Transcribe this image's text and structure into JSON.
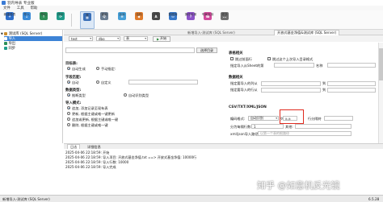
{
  "window": {
    "title": "羽内导表 专业版"
  },
  "menu": [
    "文件",
    "工具",
    "帮助"
  ],
  "toolbar": {
    "buttons": [
      {
        "label": "新建导表",
        "color": "#2f6fca"
      },
      {
        "label": "导入",
        "color": "#3b8bd8"
      },
      {
        "label": "导出",
        "color": "#2f8f57"
      },
      {
        "label": "同步",
        "color": "#1f9c8a"
      },
      {
        "label": "表",
        "color": "#3a6fb7"
      },
      {
        "label": "查询",
        "color": "#6b7d92"
      },
      {
        "label": "比对",
        "color": "#46a0d8"
      },
      {
        "label": "结构",
        "color": "#e07b2a"
      },
      {
        "label": "API",
        "color": "#4a4a4a"
      },
      {
        "label": "数据库",
        "color": "#3677c9"
      },
      {
        "label": "操作手册",
        "color": "#8c54c8"
      },
      {
        "label": "专家支持",
        "color": "#d14a9c"
      },
      {
        "label": "更多",
        "color": "#6f6f6f"
      }
    ]
  },
  "tree": {
    "root": "测试库 (SQL Server)",
    "items": [
      "导入",
      "导出",
      "同步"
    ]
  },
  "tabs": [
    "新增导入-测试库 (SQL Server)",
    "开放式基金净值&测试库 (SQL Server)"
  ],
  "selector": {
    "source_combo": "test",
    "target_combo": "dbo",
    "table_combo": "表",
    "start_label": "开始"
  },
  "form": {
    "select_file_button": "选择目录",
    "target_section": "目标表:",
    "target_auto": "自动生成",
    "target_manual": "手动指定:",
    "field_section": "字段匹配:",
    "field_auto": "自动",
    "field_custom": "自定义",
    "data_section": "数据类型:",
    "data_infer": "推断类型",
    "data_auto": "自动识别类型",
    "import_mode": "导入模式:",
    "mode_append": "追加, 添加记录至现有表",
    "mode_replace": "更新, 根据主键或唯一键更新",
    "mode_merge": "追加或更新, 根据主键或唯一键",
    "mode_delete": "删除, 根据主键或唯一键",
    "table_ops_title": "表格相关",
    "opt_header": "跳过前面行",
    "opt_remember": "跳过这个上次导入目录格式",
    "opt_rows_label": "指定导入从Sheet的第",
    "opt_rows_suffix": "名称",
    "data_range_title": "数据相关",
    "range_start": "指定要导入的列从",
    "range_to": "到",
    "range_rows": "指定要导入的行从",
    "range_rows_to": "到",
    "csv_section": "CSV/TXT/XML/JSON",
    "encoding_label": "编码格式:",
    "encoding_value": "自动识别",
    "delimiter_label": "列分隔符",
    "delimiter_value": "\\t,\\t",
    "row_delim_label": "行分隔符",
    "header_row_label": "分为每隔行数:",
    "header_row_value": "1",
    "ignore_label": "其他:",
    "xml_json_label": "xml/json导入路径:",
    "xml_json_hint": "以第一个表的根路径"
  },
  "log": {
    "tabs": [
      "日志",
      "详细信息"
    ],
    "lines": [
      "2025-04-06 22:18:59: 开始",
      "2025-04-06 22:18:59: 导入项目: 开放式基金净值.txt ==> 开放式基金净值: 10000行",
      "2025-04-06 22:18:59: 导入行数: 10000",
      "2025-04-06 22:18:59: 导入完成"
    ]
  },
  "status": {
    "left": "新增导入-测试库 (SQL Server)",
    "right": "6.5.28"
  },
  "watermark": "知乎 @如意机反光镜"
}
